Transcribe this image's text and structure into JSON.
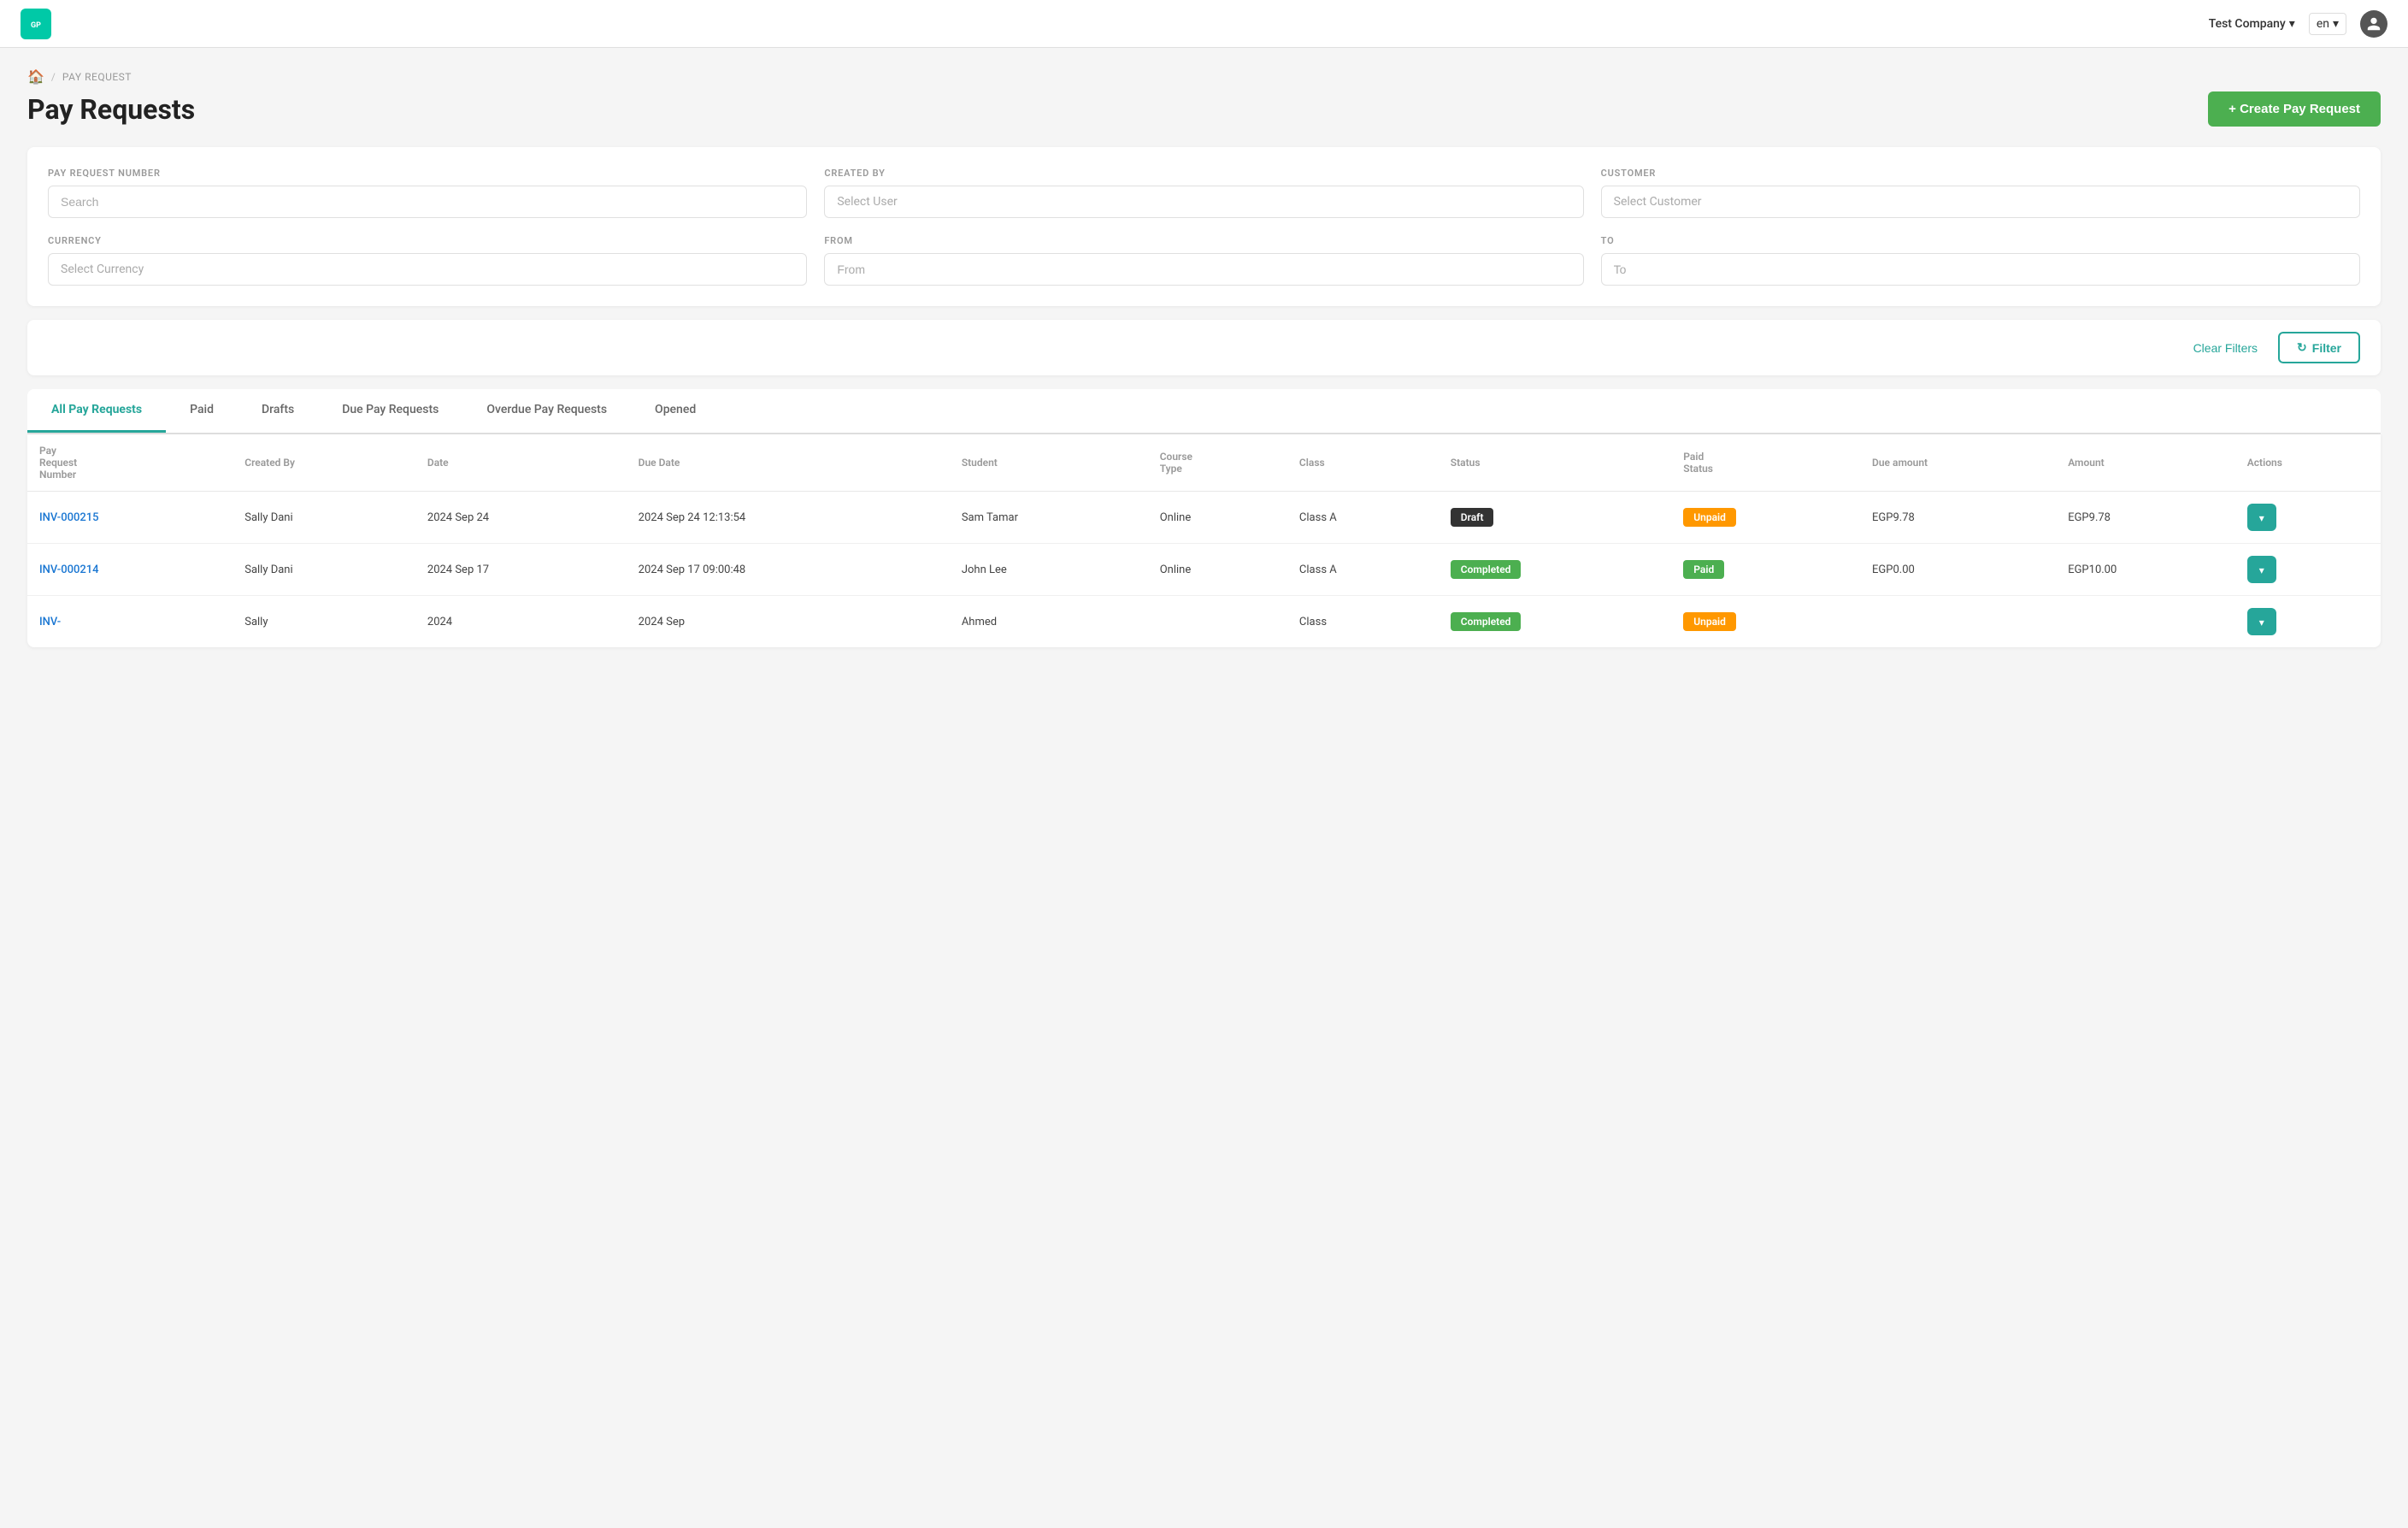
{
  "header": {
    "logo_text": "GP",
    "company_name": "Test Company",
    "language": "en",
    "user_icon": "👤"
  },
  "breadcrumb": {
    "home_icon": "🏠",
    "separator": "/",
    "current": "PAY REQUEST"
  },
  "page": {
    "title": "Pay Requests",
    "create_button": "+ Create Pay Request"
  },
  "filters": {
    "pay_request_number_label": "PAY REQUEST NUMBER",
    "pay_request_number_placeholder": "Search",
    "created_by_label": "CREATED BY",
    "created_by_placeholder": "Select User",
    "customer_label": "CUSTOMER",
    "customer_placeholder": "Select Customer",
    "currency_label": "CURRENCY",
    "currency_placeholder": "Select Currency",
    "from_label": "FROM",
    "from_placeholder": "From",
    "to_label": "TO",
    "to_placeholder": "To"
  },
  "action_bar": {
    "clear_filters_label": "Clear Filters",
    "filter_label": "Filter",
    "filter_icon": "↻"
  },
  "tabs": [
    {
      "label": "All Pay Requests",
      "active": true
    },
    {
      "label": "Paid",
      "active": false
    },
    {
      "label": "Drafts",
      "active": false
    },
    {
      "label": "Due Pay Requests",
      "active": false
    },
    {
      "label": "Overdue Pay Requests",
      "active": false
    },
    {
      "label": "Opened",
      "active": false
    }
  ],
  "table": {
    "columns": [
      "Pay Request Number",
      "Created By",
      "Date",
      "Due Date",
      "Student",
      "Course Type",
      "Class",
      "Status",
      "Paid Status",
      "Due amount",
      "Amount",
      "Actions"
    ],
    "rows": [
      {
        "inv_number": "INV-000215",
        "created_by": "Sally Dani",
        "date": "2024 Sep 24",
        "due_date": "2024 Sep 24 12:13:54",
        "student": "Sam Tamar",
        "course_type": "Online",
        "class": "Class A",
        "status": "Draft",
        "status_type": "draft",
        "paid_status": "Unpaid",
        "paid_status_type": "unpaid",
        "due_amount": "EGP9.78",
        "amount": "EGP9.78"
      },
      {
        "inv_number": "INV-000214",
        "created_by": "Sally Dani",
        "date": "2024 Sep 17",
        "due_date": "2024 Sep 17 09:00:48",
        "student": "John Lee",
        "course_type": "Online",
        "class": "Class A",
        "status": "Completed",
        "status_type": "completed",
        "paid_status": "Paid",
        "paid_status_type": "paid",
        "due_amount": "EGP0.00",
        "amount": "EGP10.00"
      },
      {
        "inv_number": "INV-",
        "created_by": "Sally",
        "date": "2024",
        "due_date": "2024 Sep",
        "student": "Ahmed",
        "course_type": "",
        "class": "Class",
        "status": "Completed",
        "status_type": "completed",
        "paid_status": "Unpaid",
        "paid_status_type": "unpaid",
        "due_amount": "",
        "amount": ""
      }
    ]
  }
}
